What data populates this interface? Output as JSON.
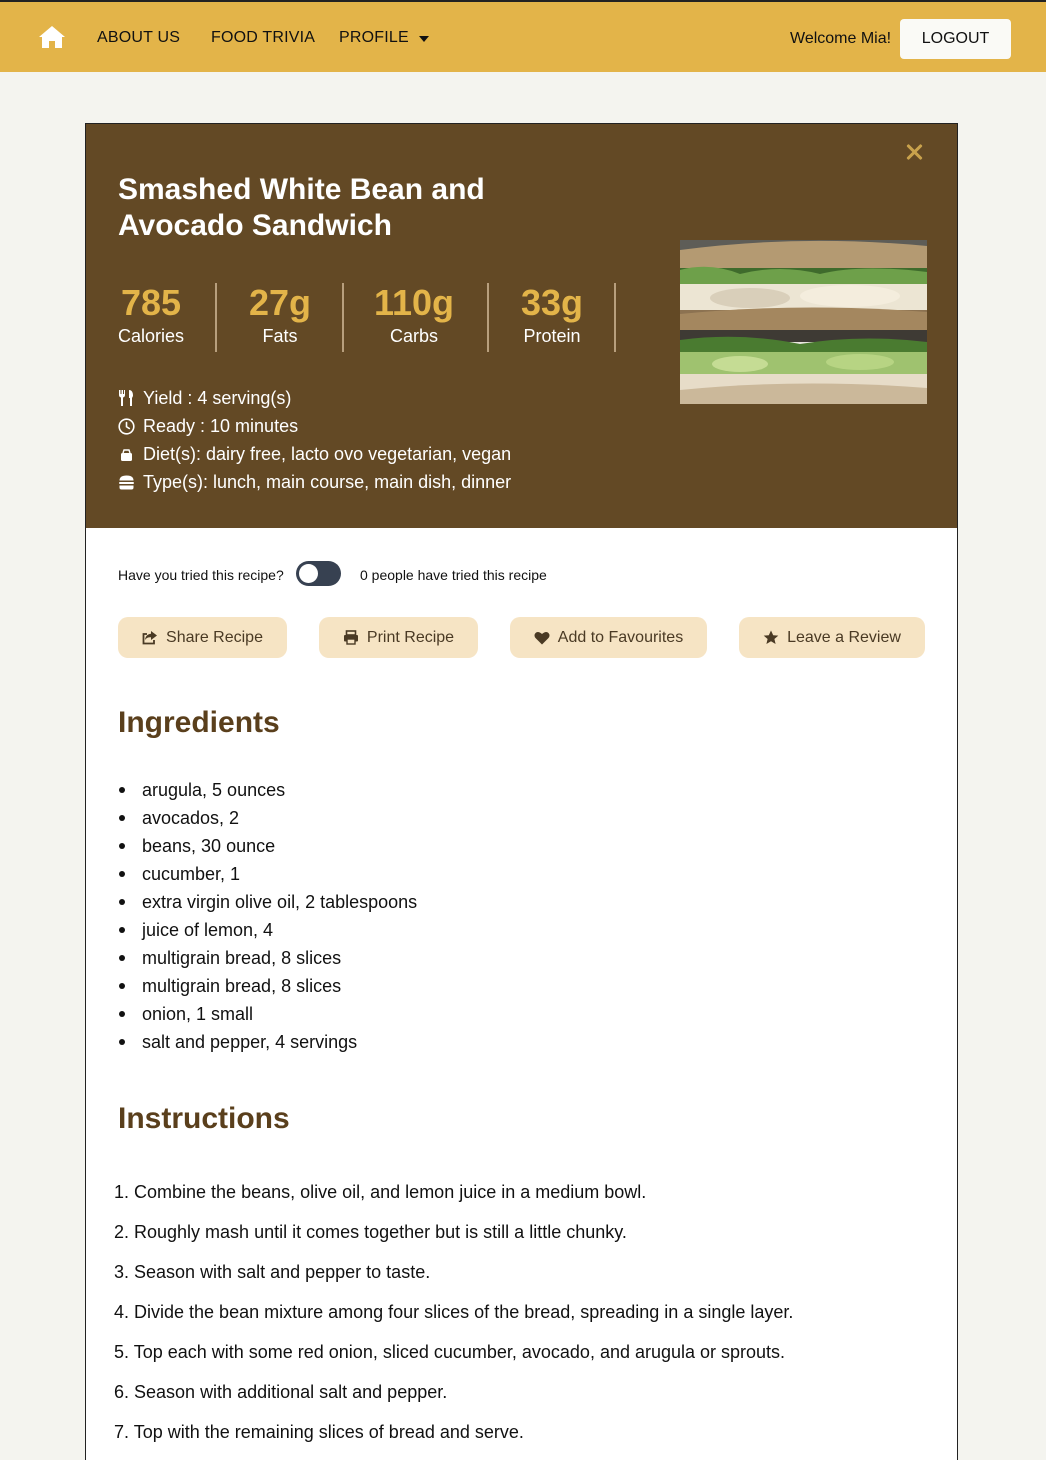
{
  "nav": {
    "about": "ABOUT US",
    "trivia": "FOOD TRIVIA",
    "profile": "PROFILE",
    "welcome": "Welcome Mia!",
    "logout": "LOGOUT"
  },
  "recipe": {
    "title": "Smashed White Bean and Avocado Sandwich",
    "stats": [
      {
        "value": "785",
        "label": "Calories"
      },
      {
        "value": "27g",
        "label": "Fats"
      },
      {
        "value": "110g",
        "label": "Carbs"
      },
      {
        "value": "33g",
        "label": "Protein"
      }
    ],
    "meta": {
      "yield": "Yield :  4 serving(s)",
      "ready": "Ready :  10 minutes",
      "diets": "Diet(s): dairy free, lacto ovo vegetarian, vegan",
      "types": "Type(s): lunch, main course, main dish, dinner"
    }
  },
  "tried": {
    "question": "Have you tried this recipe?",
    "count_text": "0 people have tried this recipe",
    "toggled": false
  },
  "actions": {
    "share": "Share Recipe",
    "print": "Print Recipe",
    "favourite": "Add to Favourites",
    "review": "Leave a Review"
  },
  "ingredients": {
    "heading": "Ingredients",
    "items": [
      "arugula, 5 ounces",
      "avocados, 2",
      "beans, 30 ounce",
      "cucumber, 1",
      "extra virgin olive oil, 2 tablespoons",
      "juice of lemon, 4",
      "multigrain bread, 8 slices",
      "multigrain bread, 8 slices",
      "onion, 1 small",
      "salt and pepper, 4 servings"
    ]
  },
  "instructions": {
    "heading": "Instructions",
    "steps": [
      "1. Combine the beans, olive oil, and lemon juice in a medium bowl.",
      "2. Roughly mash until it comes together but is still a little chunky.",
      "3. Season with salt and pepper to taste.",
      "4. Divide the bean mixture among four slices of the bread, spreading in a single layer.",
      "5. Top each with some red onion, sliced cucumber, avocado, and arugula or sprouts.",
      "6. Season with additional salt and pepper.",
      "7. Top with the remaining slices of bread and serve."
    ]
  },
  "colors": {
    "navbar": "#e3b449",
    "hero": "#634925",
    "accent": "#e3b449",
    "heading": "#5a3f1c",
    "button_bg": "#f6e4c4"
  }
}
